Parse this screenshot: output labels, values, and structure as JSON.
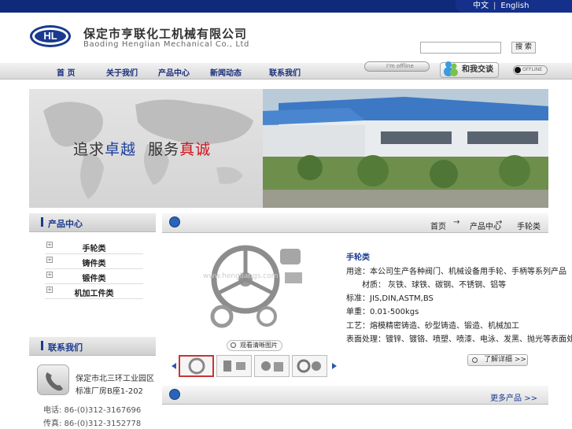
{
  "top": {
    "lang_cn": "中文",
    "lang_sep": "|",
    "lang_en": "English"
  },
  "header": {
    "logo_text": "HL",
    "company_cn": "保定市亨联化工机械有限公司",
    "company_en": "Baoding Henglian Mechanical Co., Ltd",
    "search_placeholder": "",
    "search_button": "搜 索"
  },
  "nav": {
    "items": [
      "首 页",
      "关于我们",
      "产品中心",
      "新闻动态",
      "联系我们"
    ]
  },
  "status": {
    "im_offline": "I'm offline",
    "talk_label": "和我交谈",
    "qq_offline": "OFFLINE"
  },
  "banner": {
    "slogan_a": "追求",
    "slogan_b": "卓越",
    "slogan_c": "服务",
    "slogan_d": "真诚"
  },
  "sidebar": {
    "products_title": "产品中心",
    "categories": [
      "手轮类",
      "铸件类",
      "锻件类",
      "机加工件类"
    ],
    "contact_title": "联系我们",
    "address_1": "保定市北三环工业园区",
    "address_2": "标准厂房B座1-202",
    "tel": "电话: 86-(0)312-3167696",
    "fax": "传真: 86-(0)312-3152778"
  },
  "main": {
    "breadcrumb": [
      "首页",
      "产品中心",
      "手轮类"
    ],
    "breadcrumb_arrow": "→",
    "watermark": "www.hengliangs.com",
    "view_button": "观看清晰图片",
    "product_name": "手轮类",
    "lines": [
      "用途：本公司生产各种阀门、机械设备用手轮、手柄等系列产品",
      "　　材质： 灰铁、球铁、碳钢、不锈钢、铝等",
      "标准：JIS,DIN,ASTM,BS",
      "单重：0.01-500kgs",
      "工艺：熔模精密铸造、砂型铸造、锻造、机械加工",
      "表面处理：镀锌、镀铬、喷塑、喷漆、电泳、发黑、抛光等表面处理"
    ],
    "detail_button": "了解详细 >>",
    "more_link": "更多产品 >>"
  }
}
